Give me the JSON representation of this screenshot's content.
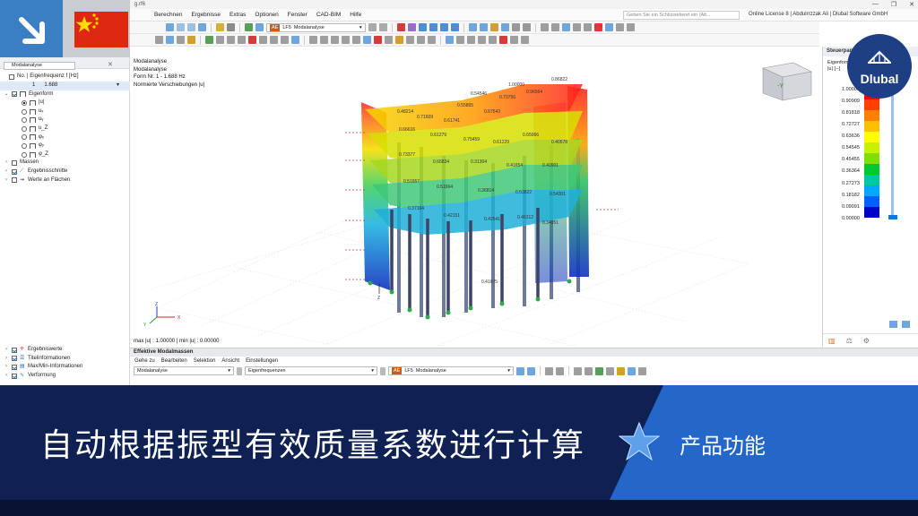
{
  "window": {
    "title": "g.rf6",
    "controls": [
      "—",
      "❐",
      "✕"
    ]
  },
  "menu": {
    "items": [
      "Berechnen",
      "Ergebnisse",
      "Extras",
      "Optionen",
      "Fenster",
      "CAD-BIM",
      "Hilfe"
    ],
    "search_placeholder": "Geben Sie ein Schlüsselwort ein (Alt...",
    "license": "Online License 8 | Abdulrrzzak Ali | Dlubal Software GmbH"
  },
  "toolbar": {
    "tag": "AE",
    "loadcase_id": "LF5",
    "loadcase_name": "Modalanalyse"
  },
  "left_panel": {
    "title": "Modalanalyse",
    "freq_header": "No. | Eigenfrequenz f [Hz]",
    "freq_no": "1",
    "freq_value": "1.688",
    "tree": {
      "eigenform": "Eigenform",
      "modes": [
        "|u|",
        "uₓ",
        "uᵧ",
        "u_Z",
        "φₓ",
        "φᵧ",
        "φ_Z"
      ],
      "massen": "Massen",
      "ergebnisschnitte": "Ergebnisschnitte",
      "werte_flaechen": "Werte an Flächen"
    },
    "bottom_items": [
      "Ergebniswerte",
      "Titelinformationen",
      "Max/Min-Informationen",
      "Verformung"
    ]
  },
  "viewport": {
    "info_lines": [
      "Modalanalyse",
      "Modalanalyse",
      "Form Nr. 1 - 1.688 Hz",
      "Normierte Verschiebungen |u|"
    ],
    "footer": "max |u| : 1.00000 | min |u| : 0.00000",
    "axis_x": "X",
    "axis_y": "Y",
    "axis_z": "Z",
    "cube_label": "-Y",
    "labels": [
      "1.00000",
      "0.86822",
      "0.96564",
      "0.54546",
      "0.70756",
      "0.55865",
      "0.67543",
      "0.61741",
      "0.71609",
      "0.48214",
      "0.66616",
      "0.61279",
      "0.75459",
      "0.61229",
      "0.65066",
      "0.40578",
      "0.73377",
      "0.66834",
      "0.31304",
      "0.41654",
      "0.40901",
      "0.51657",
      "0.51664",
      "0.36814",
      "0.53822",
      "0.54301",
      "0.37164",
      "0.42151",
      "0.42541",
      "0.46312",
      "0.34951",
      "0.41675"
    ]
  },
  "right_panel": {
    "title": "Steuerpan",
    "legend_title": "Eigenform",
    "legend_unit": "|u| [--]",
    "values": [
      "1.00000",
      "0.90909",
      "0.81818",
      "0.72727",
      "0.63636",
      "0.54545",
      "0.45455",
      "0.36364",
      "0.27273",
      "0.18182",
      "0.09091",
      "0.00000"
    ],
    "colors": [
      "#ff0000",
      "#ff4000",
      "#ff8000",
      "#ffbf00",
      "#ffff00",
      "#c8f000",
      "#7fe000",
      "#00c832",
      "#00c8a0",
      "#00a8ff",
      "#0060ff",
      "#0000c8"
    ]
  },
  "brand": {
    "name": "Dlubal"
  },
  "bottom_panel": {
    "title": "Effektive Modalmassen",
    "menu": [
      "Gehe zu",
      "Bearbeiten",
      "Selektion",
      "Ansicht",
      "Einstellungen"
    ],
    "dropdown1": "Modalanalyse",
    "dropdown2": "Eigenfrequenzen",
    "tag": "AE",
    "loadcase_id": "LF5",
    "loadcase_name": "Modalanalyse"
  },
  "banner": {
    "title": "自动根据振型有效质量系数进行计算",
    "tag": "产品功能"
  }
}
